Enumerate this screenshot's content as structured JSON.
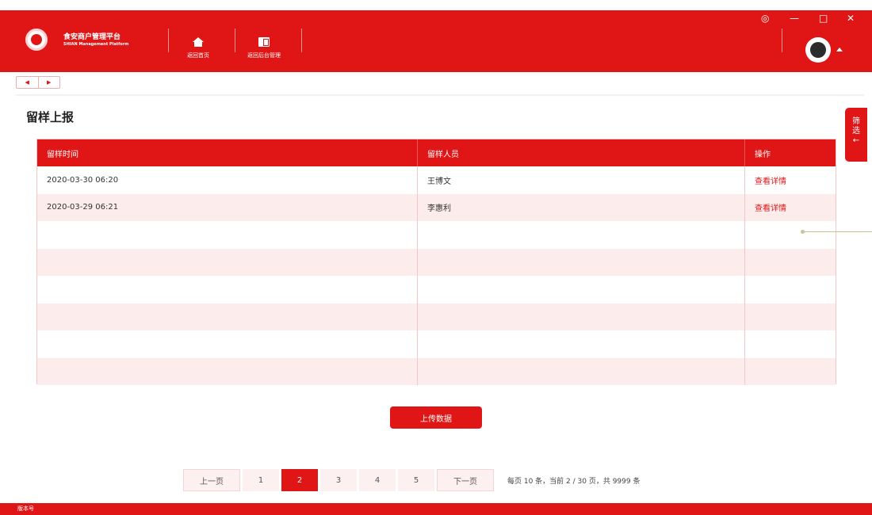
{
  "header": {
    "brand_title": "食安商户管理平台",
    "brand_subtitle": "SHIAN Management Platform",
    "nav": [
      {
        "label": "返回首页",
        "icon": "home-icon"
      },
      {
        "label": "返回后台管理",
        "icon": "book-icon"
      }
    ],
    "window_controls": {
      "target": "◎",
      "minimize": "—",
      "maximize": "□",
      "close": "✕"
    }
  },
  "tabnav": {
    "prev": "◀",
    "next": "▶"
  },
  "page": {
    "title": "留样上报"
  },
  "filter": {
    "label1": "筛",
    "label2": "选",
    "arrow": "←"
  },
  "table": {
    "headers": [
      "留样时间",
      "留样人员",
      "操作"
    ],
    "rows": [
      {
        "time": "2020-03-30 06:20",
        "person": "王博文",
        "action": "查看详情"
      },
      {
        "time": "2020-03-29 06:21",
        "person": "李惠利",
        "action": "查看详情"
      }
    ]
  },
  "upload_button": "上传数据",
  "pagination": {
    "prev": "上一页",
    "next": "下一页",
    "pages": [
      "1",
      "2",
      "3",
      "4",
      "5"
    ],
    "current": "2",
    "info": "每页 10 条，当前 2 / 30 页，共 9999 条"
  },
  "footer": {
    "version_label": "版本号"
  },
  "colors": {
    "accent": "#e01515",
    "row_stripe": "#fdecec"
  }
}
